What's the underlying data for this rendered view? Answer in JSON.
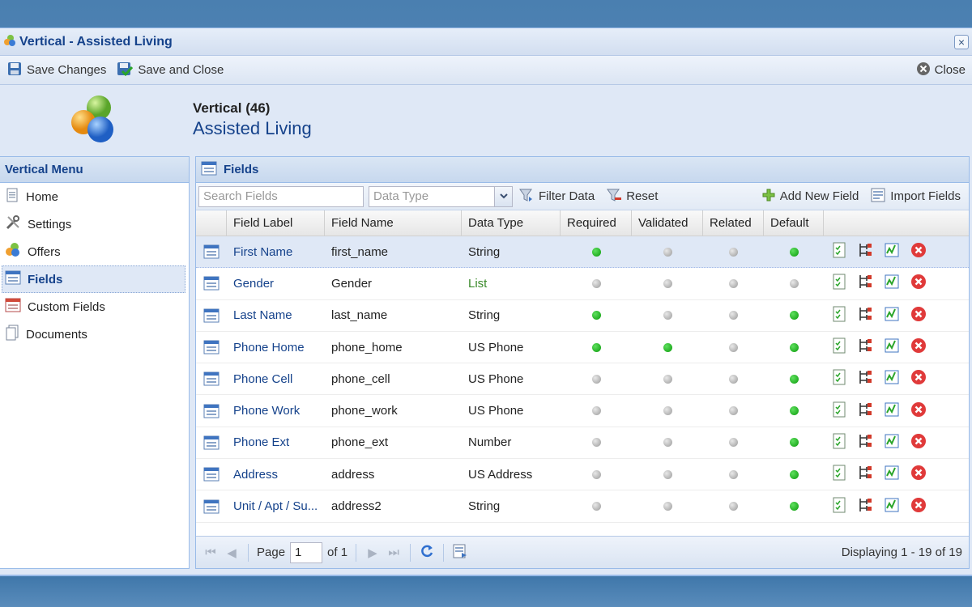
{
  "window": {
    "title": "Vertical - Assisted Living",
    "close_glyph": "×"
  },
  "toolbar": {
    "save_changes": "Save Changes",
    "save_and_close": "Save and Close",
    "close": "Close"
  },
  "header": {
    "line1": "Vertical (46)",
    "line2": "Assisted Living"
  },
  "sidebar": {
    "title": "Vertical Menu",
    "items": [
      {
        "label": "Home",
        "icon": "page-icon"
      },
      {
        "label": "Settings",
        "icon": "tools-icon"
      },
      {
        "label": "Offers",
        "icon": "shapes-icon"
      },
      {
        "label": "Fields",
        "icon": "form-icon",
        "active": true
      },
      {
        "label": "Custom Fields",
        "icon": "custom-form-icon"
      },
      {
        "label": "Documents",
        "icon": "documents-icon"
      }
    ]
  },
  "fields_panel": {
    "title": "Fields",
    "search_placeholder": "Search Fields",
    "datatype_placeholder": "Data Type",
    "filter_label": "Filter Data",
    "reset_label": "Reset",
    "add_label": "Add New Field",
    "import_label": "Import Fields"
  },
  "columns": [
    "Field Label",
    "Field Name",
    "Data Type",
    "Required",
    "Validated",
    "Related",
    "Default"
  ],
  "rows": [
    {
      "label": "First Name",
      "name": "first_name",
      "type": "String",
      "required": true,
      "validated": false,
      "related": false,
      "default": true
    },
    {
      "label": "Gender",
      "name": "Gender",
      "type": "List",
      "required": false,
      "validated": false,
      "related": false,
      "default": false
    },
    {
      "label": "Last Name",
      "name": "last_name",
      "type": "String",
      "required": true,
      "validated": false,
      "related": false,
      "default": true
    },
    {
      "label": "Phone Home",
      "name": "phone_home",
      "type": "US Phone",
      "required": true,
      "validated": true,
      "related": false,
      "default": true
    },
    {
      "label": "Phone Cell",
      "name": "phone_cell",
      "type": "US Phone",
      "required": false,
      "validated": false,
      "related": false,
      "default": true
    },
    {
      "label": "Phone Work",
      "name": "phone_work",
      "type": "US Phone",
      "required": false,
      "validated": false,
      "related": false,
      "default": true
    },
    {
      "label": "Phone Ext",
      "name": "phone_ext",
      "type": "Number",
      "required": false,
      "validated": false,
      "related": false,
      "default": true
    },
    {
      "label": "Address",
      "name": "address",
      "type": "US Address",
      "required": false,
      "validated": false,
      "related": false,
      "default": true
    },
    {
      "label": "Unit / Apt / Su...",
      "name": "address2",
      "type": "String",
      "required": false,
      "validated": false,
      "related": false,
      "default": true
    }
  ],
  "pager": {
    "page_label": "Page",
    "page_value": "1",
    "of_label": "of 1",
    "display": "Displaying 1 - 19 of 19"
  },
  "colors": {
    "accent": "#15428b",
    "on": "#1aa51a",
    "off": "#a9a9a9",
    "delete": "#e03a3a"
  }
}
